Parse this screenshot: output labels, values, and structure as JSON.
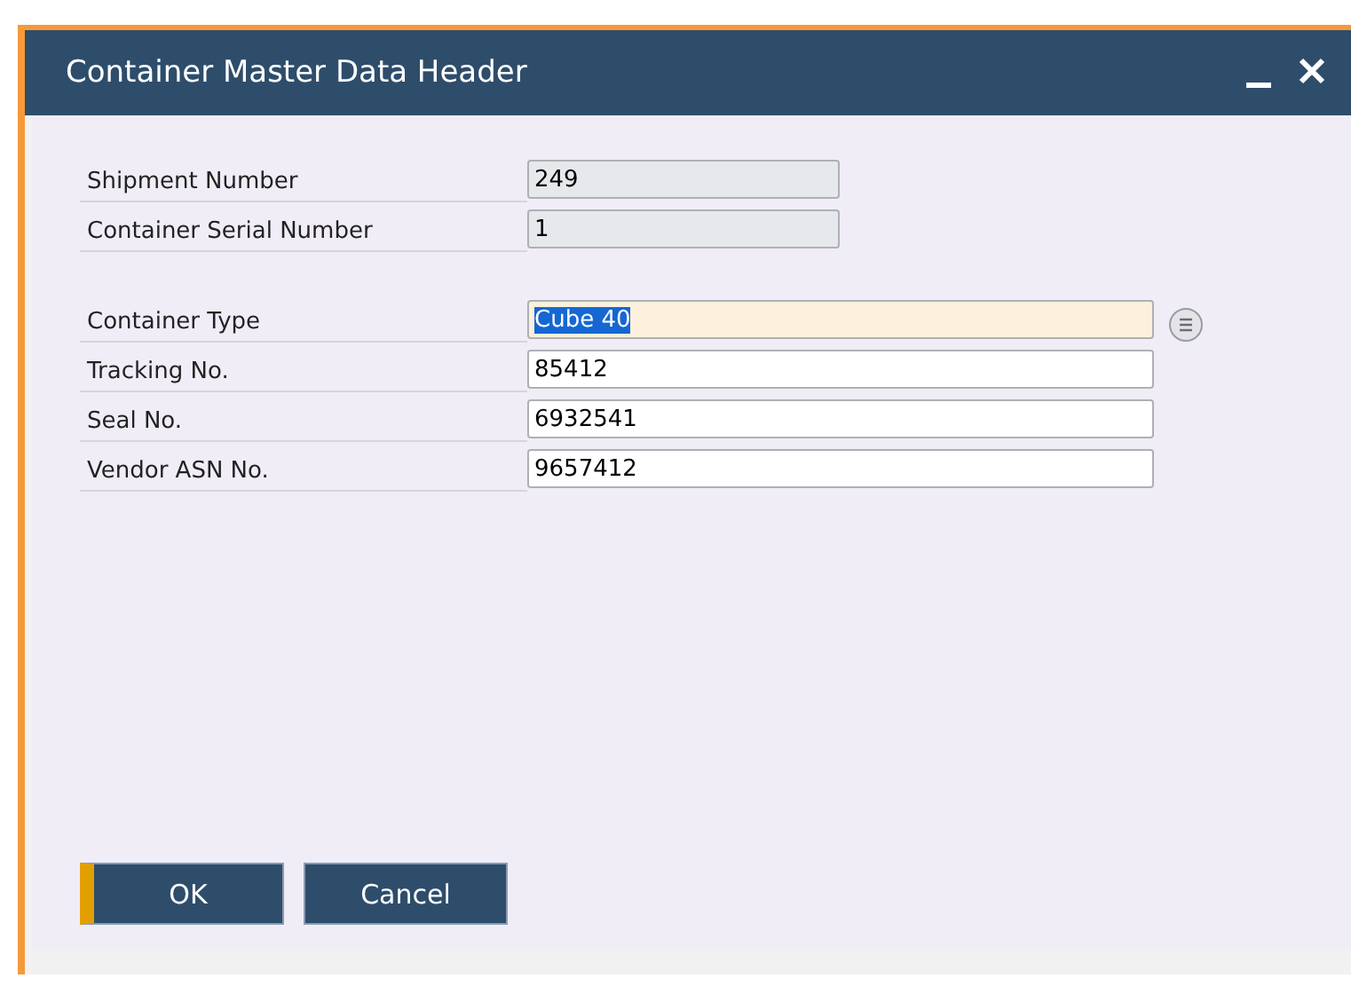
{
  "window": {
    "title": "Container Master Data Header",
    "controls": [
      {
        "kind": "minimize"
      },
      {
        "kind": "close"
      }
    ]
  },
  "groups": [
    [
      {
        "label": "Shipment Number",
        "value": "249",
        "kind": "readonly",
        "focused": false,
        "lookup": false
      },
      {
        "label": "Container Serial Number",
        "value": "1",
        "kind": "readonly",
        "focused": false,
        "lookup": false
      }
    ],
    [
      {
        "label": "Container Type",
        "value": "Cube 40",
        "kind": "editable",
        "focused": true,
        "lookup": true
      },
      {
        "label": "Tracking No.",
        "value": "85412",
        "kind": "editable",
        "focused": false,
        "lookup": false
      },
      {
        "label": "Seal No.",
        "value": "6932541",
        "kind": "editable",
        "focused": false,
        "lookup": false
      },
      {
        "label": "Vendor ASN No.",
        "value": "9657412",
        "kind": "editable",
        "focused": false,
        "lookup": false
      }
    ]
  ],
  "buttons": [
    {
      "label": "OK",
      "default": true
    },
    {
      "label": "Cancel",
      "default": false
    }
  ]
}
